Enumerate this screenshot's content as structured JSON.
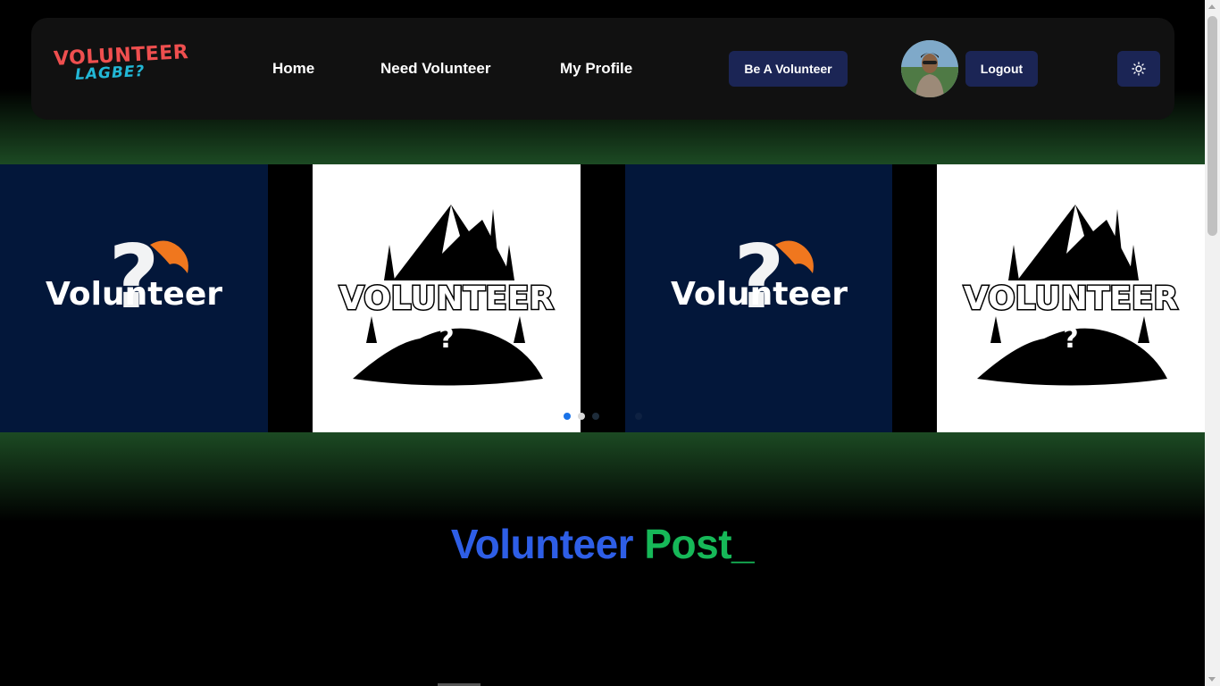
{
  "brand": {
    "logo_line1": "VOLUNTEER",
    "logo_line2": "LAGBE?"
  },
  "nav": {
    "links": [
      "Home",
      "Need Volunteer",
      "My Profile"
    ],
    "be_volunteer_label": "Be A Volunteer",
    "logout_label": "Logout",
    "theme_icon": "sun-icon"
  },
  "slides": [
    {
      "variant": "navy",
      "text": "Volunteer"
    },
    {
      "variant": "white",
      "text": "VOLUNTEER"
    },
    {
      "variant": "navy",
      "text": "Volunteer"
    },
    {
      "variant": "white",
      "text": "VOLUNTEER"
    }
  ],
  "carousel": {
    "dot_count": 4,
    "active_dot": 0
  },
  "section": {
    "title_part1": "Volunteer",
    "title_part2": "Post",
    "cursor": "_"
  },
  "colors": {
    "background": "#000000",
    "navbar": "#111111",
    "button": "#1b2555",
    "accent_blue": "#2e5ee6",
    "accent_green": "#16b858",
    "glow_green": "#1c4a23",
    "slide_navy": "#03173a",
    "logo_red": "#ef4f4f",
    "logo_cyan": "#22b7d6",
    "flame_orange": "#f0771e",
    "active_dot": "#1a73e8"
  }
}
